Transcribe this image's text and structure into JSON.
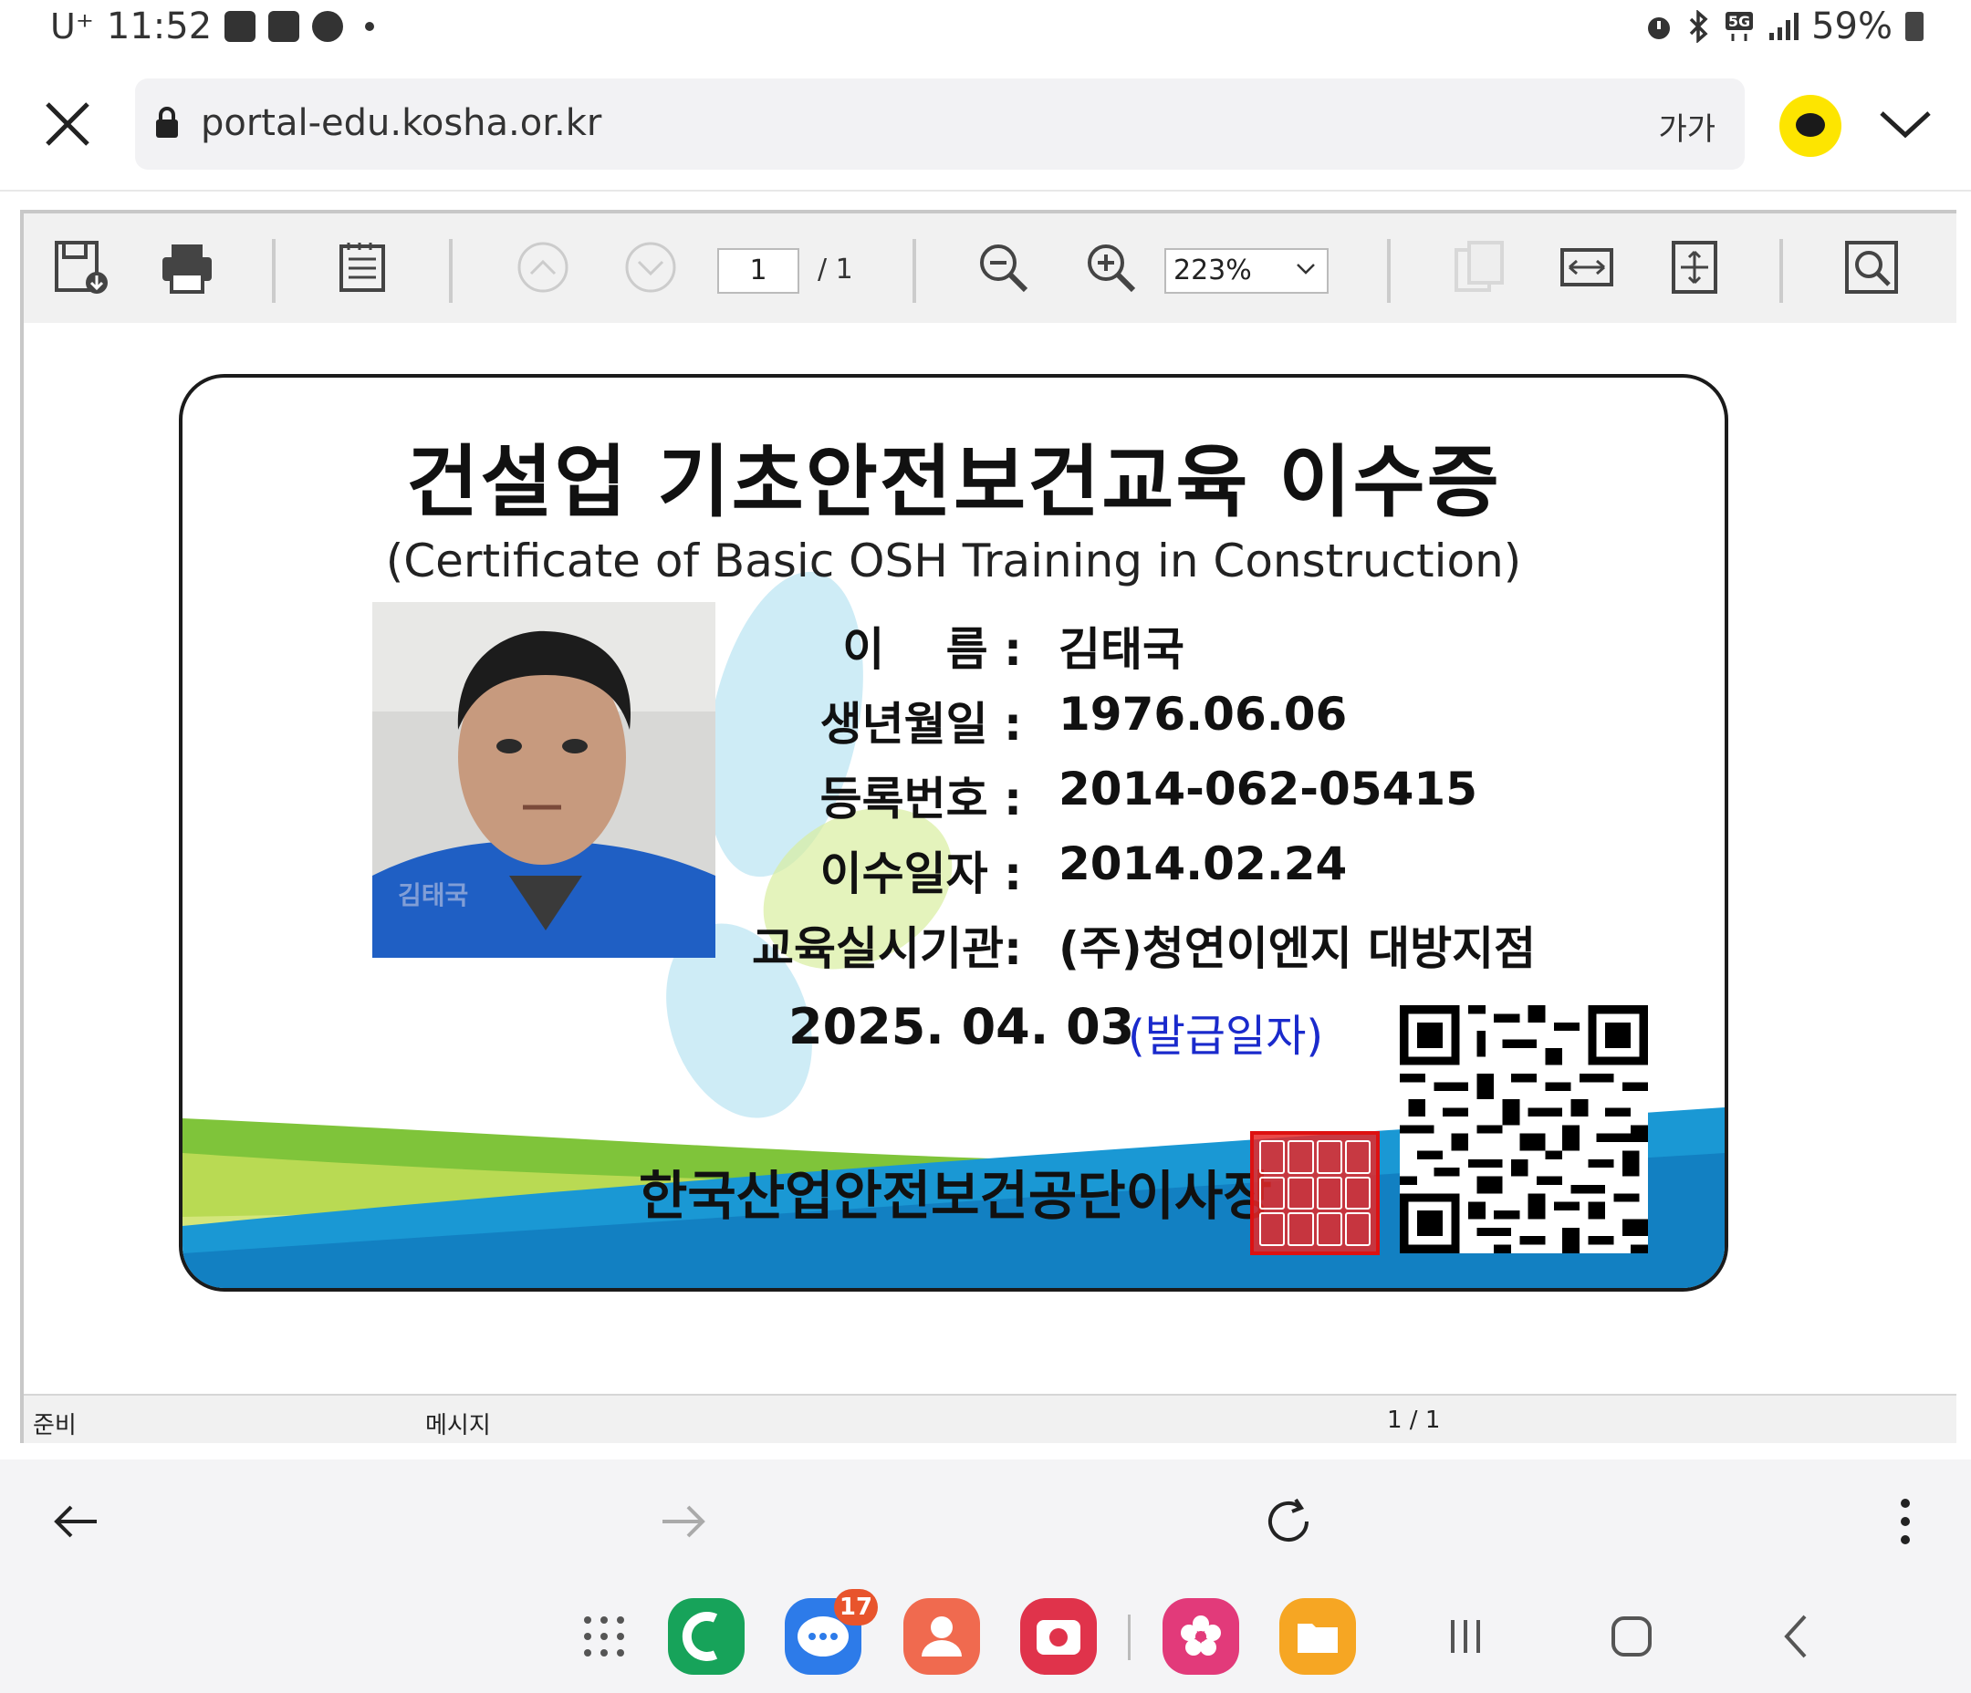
{
  "status_bar": {
    "carrier": "U⁺",
    "time": "11:52",
    "battery": "59%"
  },
  "browser": {
    "url": "portal-edu.kosha.or.kr",
    "text_size_label": "가가"
  },
  "pdf_toolbar": {
    "page_current": "1",
    "page_total": "/  1",
    "zoom": "223%"
  },
  "pdf_status": {
    "ready": "준비",
    "message": "메시지",
    "pages": "1 / 1"
  },
  "certificate": {
    "title": "건설업 기초안전보건교육 이수증",
    "subtitle": "(Certificate of Basic OSH Training in Construction)",
    "photo_watermark": "김태국",
    "fields": [
      {
        "label": "이　 름 :",
        "value": "김태국"
      },
      {
        "label": "생년월일 :",
        "value": "1976.06.06"
      },
      {
        "label": "등록번호 :",
        "value": "2014-062-05415"
      },
      {
        "label": "이수일자 :",
        "value": "2014.02.24"
      },
      {
        "label": "교육실시기관:",
        "value": "(주)청연이엔지 대방지점"
      }
    ],
    "issue_date": "2025. 04. 03",
    "issue_date_label": "(발급일자)",
    "signer": "한국산업안전보건공단이사장"
  },
  "dock": {
    "messages_badge": "17"
  }
}
